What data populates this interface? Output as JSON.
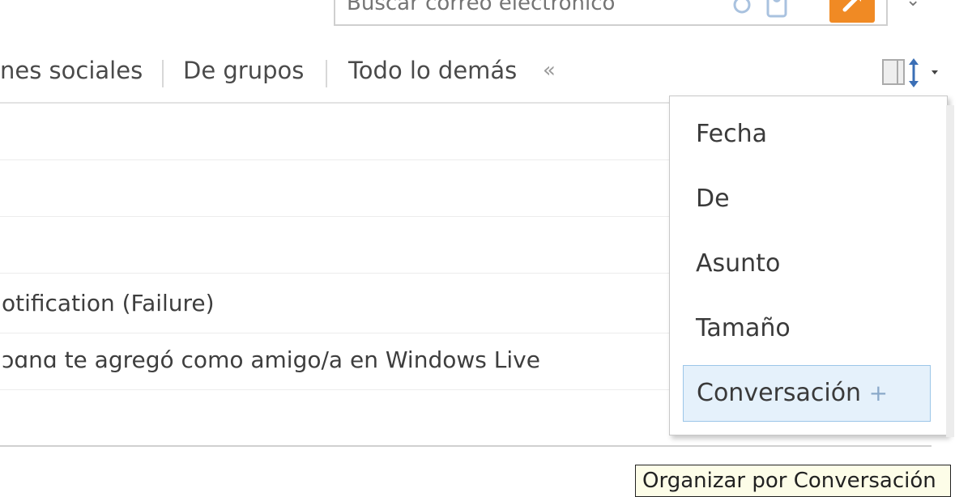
{
  "search": {
    "placeholder": "Buscar correo electrónico"
  },
  "filters": {
    "items": [
      {
        "label": "nes sociales"
      },
      {
        "label": "De grupos"
      },
      {
        "label": "Todo lo demás"
      }
    ],
    "collapse_label": "«"
  },
  "messages": [
    {
      "subject": ""
    },
    {
      "subject": ""
    },
    {
      "subject": ""
    },
    {
      "subject": "otification (Failure)"
    },
    {
      "subject": "ɔɑnɑ te agregó como amigo/a en Windows Live"
    },
    {
      "subject": ""
    }
  ],
  "sort_menu": {
    "items": [
      {
        "label": "Fecha"
      },
      {
        "label": "De"
      },
      {
        "label": "Asunto"
      },
      {
        "label": "Tamaño"
      },
      {
        "label": "Conversación"
      }
    ],
    "selected_index": 4,
    "selected_icon": "plus-icon"
  },
  "tooltip": {
    "text": "Organizar por Conversación"
  },
  "colors": {
    "accent_orange": "#f08a24",
    "selection_bg": "#e5f1fb",
    "selection_border": "#9cc6e8"
  },
  "icons": [
    "search-icon",
    "people-icon",
    "view-toggle-icon",
    "chevron-down-icon",
    "plus-icon"
  ]
}
